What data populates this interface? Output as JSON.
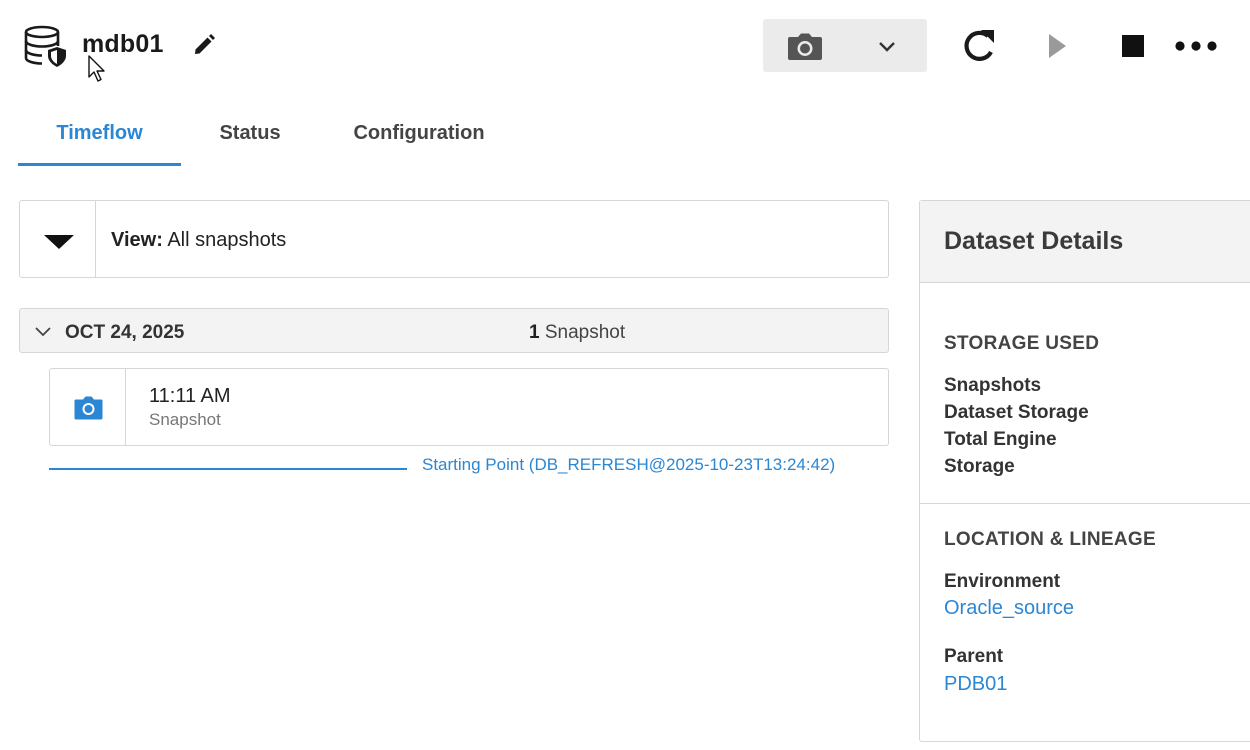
{
  "header": {
    "title": "mdb01"
  },
  "icons": {
    "database": "database-icon",
    "edit": "pencil-icon",
    "camera": "camera-icon",
    "chevron": "chevron-down-icon",
    "refresh": "refresh-icon",
    "play": "play-icon",
    "stop": "stop-icon",
    "more": "more-icon"
  },
  "tabs": [
    {
      "label": "Timeflow",
      "active": true
    },
    {
      "label": "Status",
      "active": false
    },
    {
      "label": "Configuration",
      "active": false
    }
  ],
  "view": {
    "label": "View:",
    "value": "All snapshots"
  },
  "timeline": {
    "day": {
      "date": "OCT 24, 2025",
      "count": "1",
      "count_label": "Snapshot"
    },
    "snapshot": {
      "time": "11:11 AM",
      "type": "Snapshot"
    },
    "starting_point": "Starting Point (DB_REFRESH@2025-10-23T13:24:42)"
  },
  "details": {
    "title": "Dataset Details",
    "storage": {
      "heading": "STORAGE USED",
      "rows": [
        "Snapshots",
        "Dataset Storage",
        "Total Engine",
        "Storage"
      ]
    },
    "location": {
      "heading": "LOCATION & LINEAGE",
      "environment_label": "Environment",
      "environment_value": "Oracle_source",
      "parent_label": "Parent",
      "parent_value": "PDB01"
    }
  },
  "colors": {
    "accent": "#2b87d3",
    "panel_bg": "#f3f3f3",
    "border": "#d6d6d6"
  }
}
